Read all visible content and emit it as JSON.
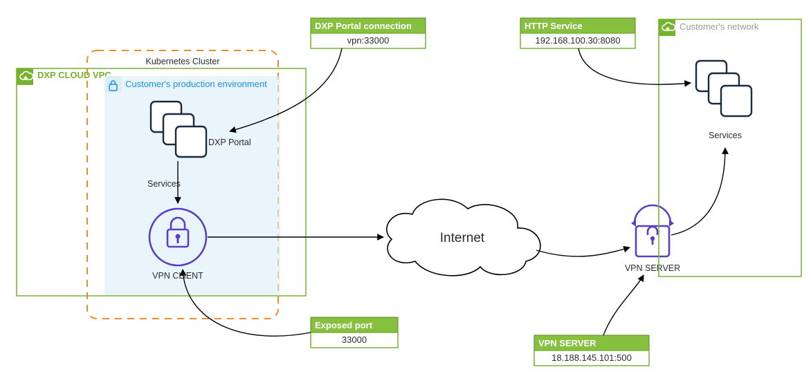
{
  "colors": {
    "green": "#76b22e",
    "orange": "#f08c23",
    "env_fill": "#dbeff7",
    "purple": "#5a3fc2",
    "navy": "#1a2940",
    "blue_link": "#1b8cf2",
    "grey_text": "#9a9a9a"
  },
  "left_cloud": {
    "title": "DXP CLOUD VPC",
    "cluster_label": "Kubernetes Cluster",
    "env_title": "Customer's production environment",
    "dxp_portal_label": "DXP Portal",
    "services_label": "Services",
    "vpn_client_label": "VPN CLIENT"
  },
  "callouts": {
    "dxp_portal": {
      "title": "DXP Portal connection",
      "value": "vpn:33000"
    },
    "exposed_port": {
      "title": "Exposed port",
      "value": "33000"
    },
    "http_service": {
      "title": "HTTP Service",
      "value": "192.168.100.30:8080"
    },
    "vpn_server": {
      "title": "VPN SERVER",
      "value": "18.188.145.101:500"
    }
  },
  "internet_label": "Internet",
  "vpn_server_label": "VPN SERVER",
  "right_cloud": {
    "title": "Customer's network",
    "services_label": "Services"
  }
}
